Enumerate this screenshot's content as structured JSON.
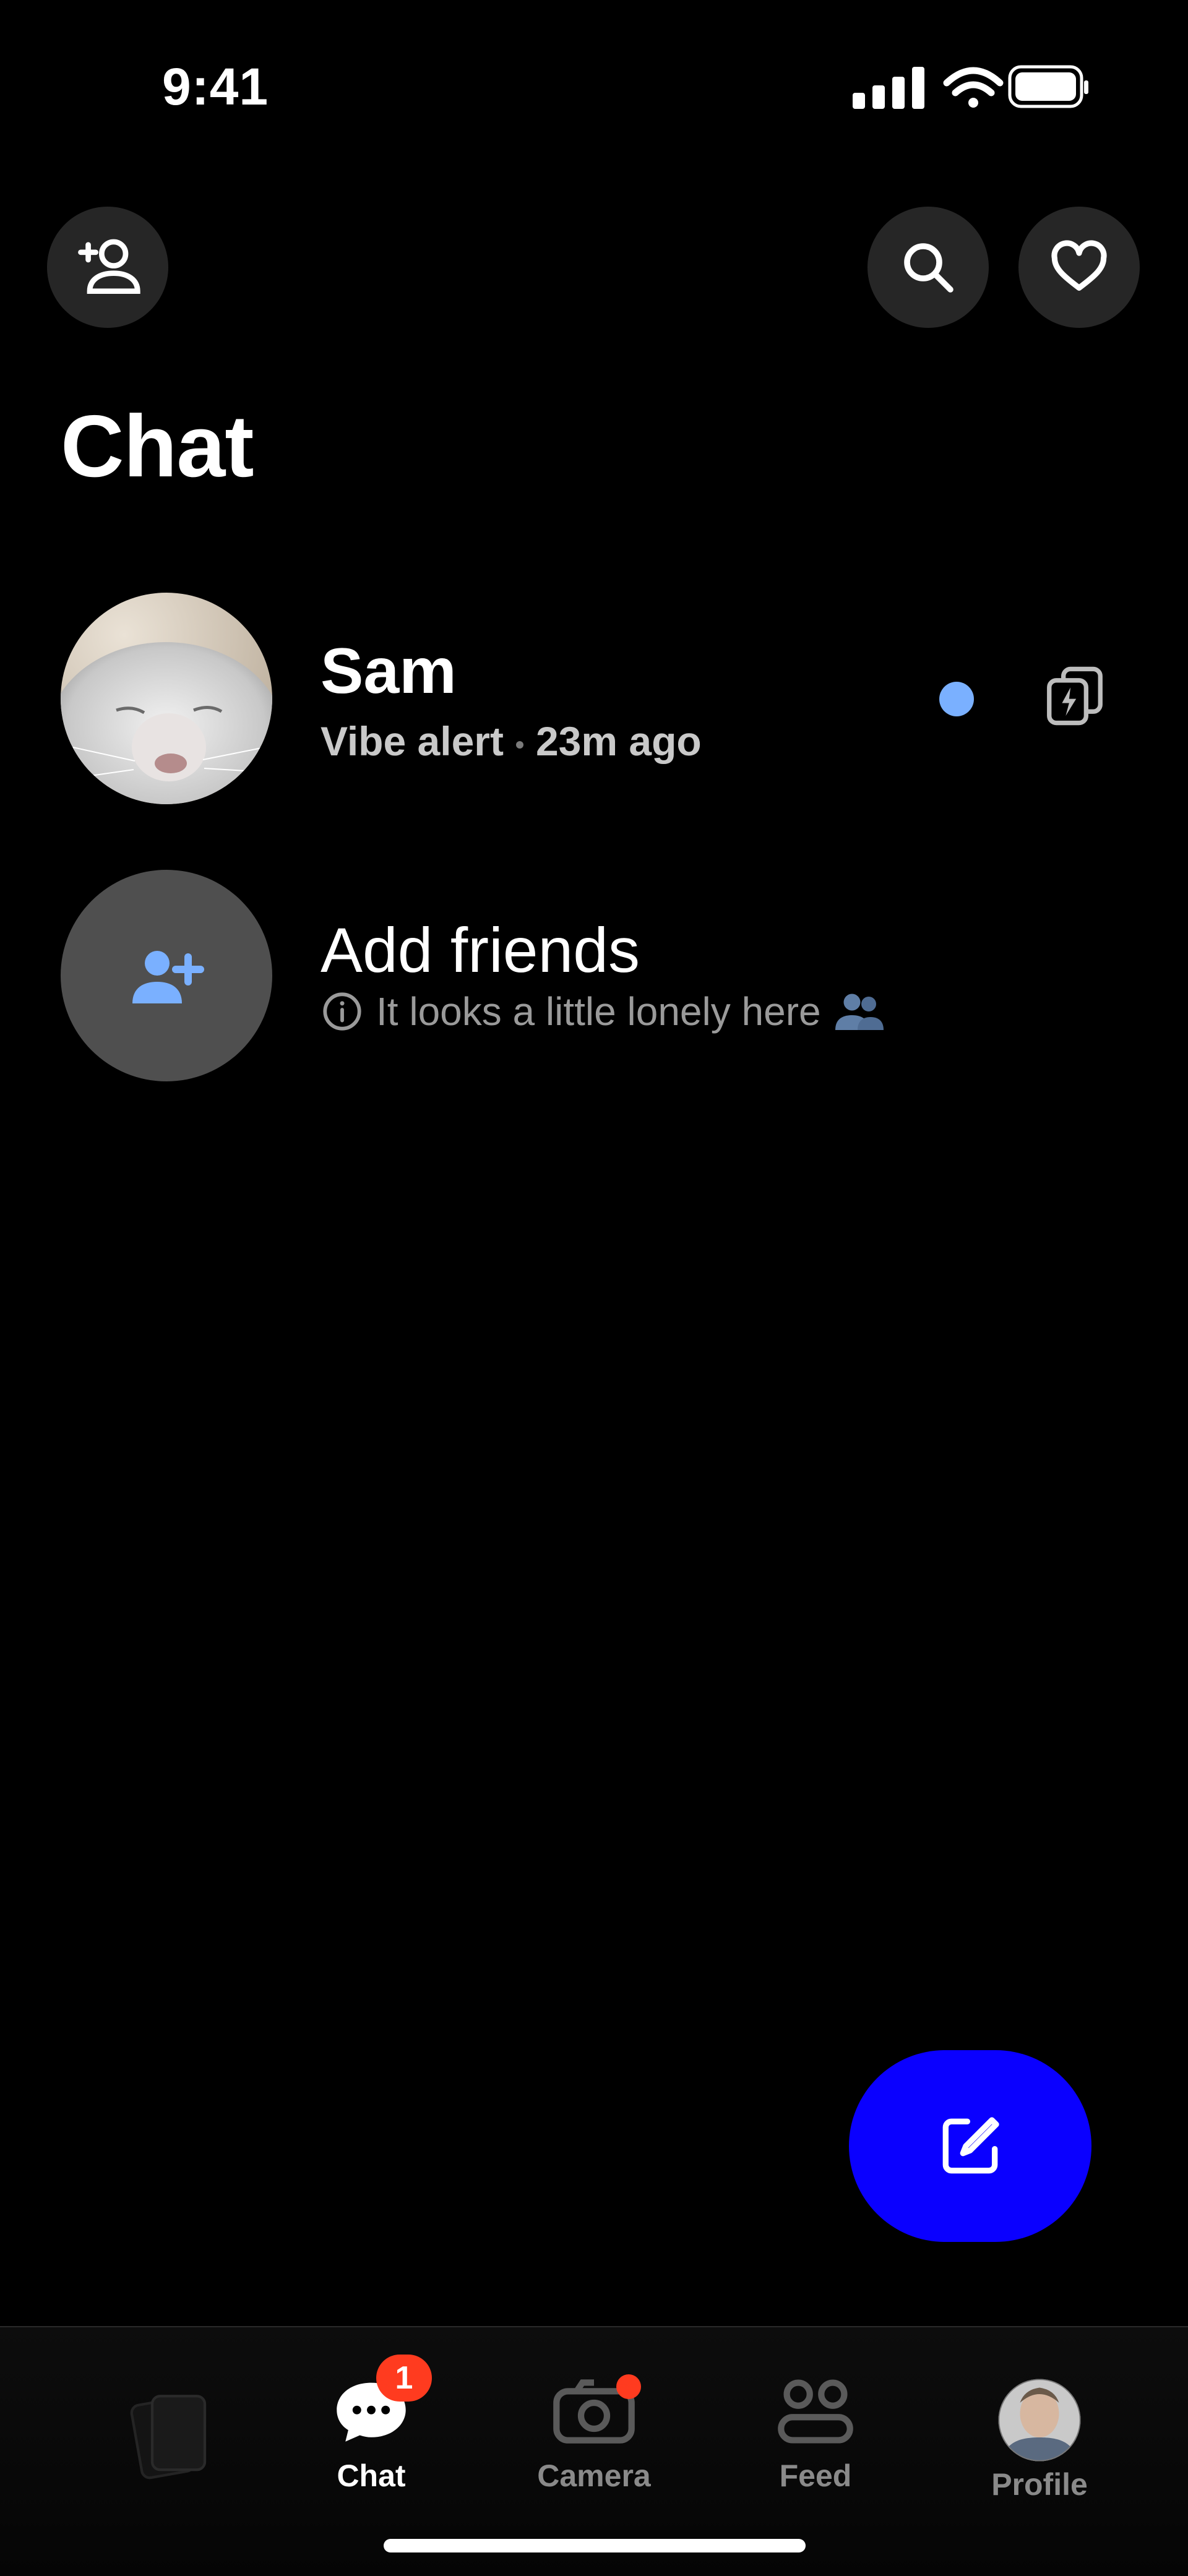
{
  "status_bar": {
    "time": "9:41"
  },
  "header": {
    "title": "Chat"
  },
  "chats": [
    {
      "name": "Sam",
      "message": "Vibe alert",
      "time": "23m ago",
      "unread": true
    }
  ],
  "add_friends": {
    "title": "Add friends",
    "subtitle": "It looks a little lonely here"
  },
  "tabs": [
    {
      "label": "Chat",
      "badge": "1",
      "active": true
    },
    {
      "label": "Camera",
      "active": false
    },
    {
      "label": "Feed",
      "active": false
    },
    {
      "label": "Profile",
      "active": false
    }
  ],
  "icons": {
    "add_friend": "add-friend-icon",
    "search": "search-icon",
    "favorites": "heart-icon",
    "stack": "flash-stack-icon",
    "compose": "compose-icon"
  },
  "colors": {
    "accent": "#0a00ff",
    "unread": "#7ab0ff",
    "badge": "#ff3b1f"
  }
}
